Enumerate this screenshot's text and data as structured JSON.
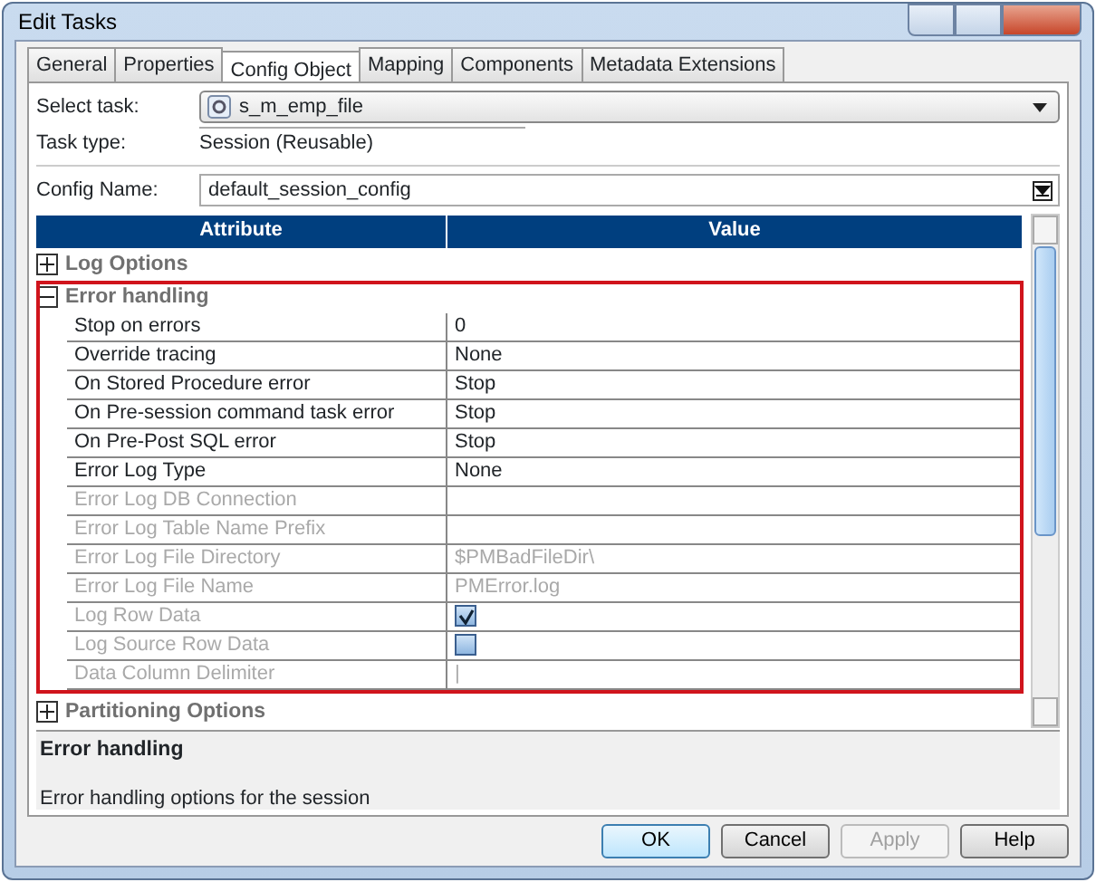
{
  "window": {
    "title": "Edit Tasks"
  },
  "tabs": [
    {
      "label": "General",
      "selected": false
    },
    {
      "label": "Properties",
      "selected": false
    },
    {
      "label": "Config Object",
      "selected": true
    },
    {
      "label": "Mapping",
      "selected": false
    },
    {
      "label": "Components",
      "selected": false
    },
    {
      "label": "Metadata Extensions",
      "selected": false
    }
  ],
  "select_task": {
    "label": "Select task:",
    "value": "s_m_emp_file"
  },
  "task_type": {
    "label": "Task type:",
    "value": "Session (Reusable)"
  },
  "config_name": {
    "label": "Config Name:",
    "value": "default_session_config"
  },
  "grid": {
    "columns": [
      "Attribute",
      "Value"
    ],
    "groups": [
      {
        "name": "Log Options",
        "expanded": false
      },
      {
        "name": "Error handling",
        "expanded": true,
        "rows": [
          {
            "attribute": "Stop on errors",
            "kind": "text",
            "value": "0",
            "disabled": false
          },
          {
            "attribute": "Override tracing",
            "kind": "text",
            "value": "None",
            "disabled": false
          },
          {
            "attribute": "On Stored Procedure error",
            "kind": "text",
            "value": "Stop",
            "disabled": false
          },
          {
            "attribute": "On Pre-session command task error",
            "kind": "text",
            "value": "Stop",
            "disabled": false
          },
          {
            "attribute": "On Pre-Post SQL error",
            "kind": "text",
            "value": "Stop",
            "disabled": false
          },
          {
            "attribute": "Error Log Type",
            "kind": "text",
            "value": "None",
            "disabled": false
          },
          {
            "attribute": "Error Log DB Connection",
            "kind": "text",
            "disabled": true
          },
          {
            "attribute": "Error Log Table Name Prefix",
            "kind": "text",
            "disabled": true
          },
          {
            "attribute": "Error Log File Directory",
            "kind": "text",
            "value": "$PMBadFileDir\\",
            "disabled": true
          },
          {
            "attribute": "Error Log File Name",
            "kind": "text",
            "value": "PMError.log",
            "disabled": true
          },
          {
            "attribute": "Log Row Data",
            "kind": "checkbox",
            "checked": true,
            "disabled": true
          },
          {
            "attribute": "Log Source Row Data",
            "kind": "checkbox",
            "checked": false,
            "disabled": true
          },
          {
            "attribute": "Data Column Delimiter",
            "kind": "text",
            "value": "|",
            "disabled": true
          }
        ]
      },
      {
        "name": "Partitioning Options",
        "expanded": false
      }
    ]
  },
  "description": {
    "title": "Error handling",
    "text": "Error handling options for the session"
  },
  "buttons": [
    {
      "label": "OK",
      "disabled": false,
      "default": true
    },
    {
      "label": "Cancel",
      "disabled": false,
      "default": false
    },
    {
      "label": "Apply",
      "disabled": true,
      "default": false
    },
    {
      "label": "Help",
      "disabled": false,
      "default": false
    }
  ]
}
